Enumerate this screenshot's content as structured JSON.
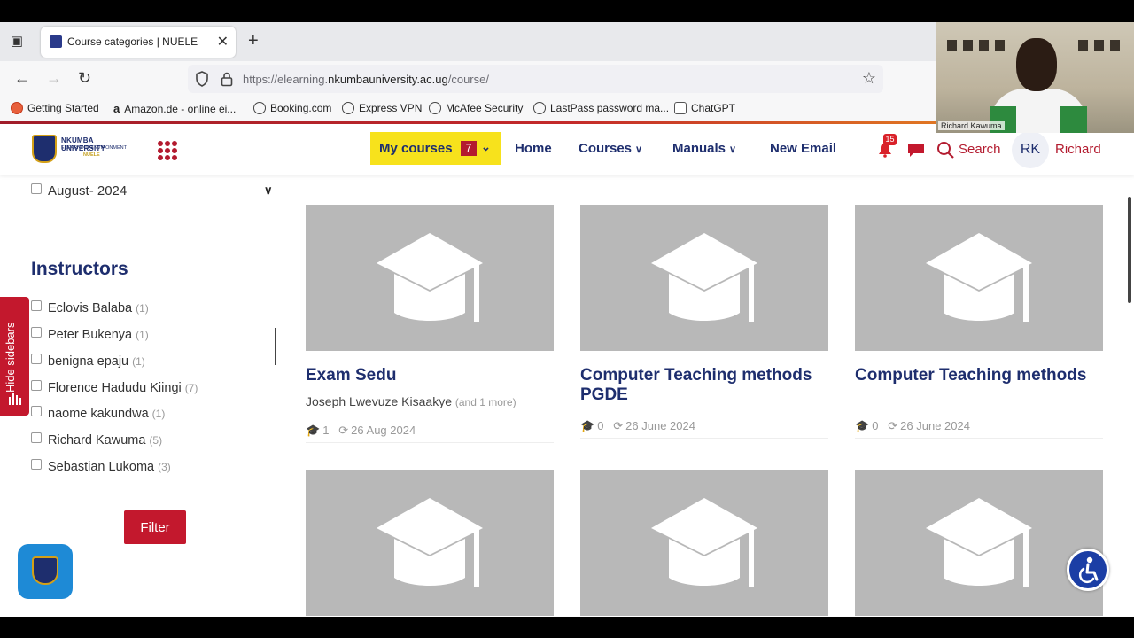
{
  "browser": {
    "tab_title": "Course categories | NUELE",
    "url_prefix": "https://elearning.",
    "url_domain": "nkumbauniversity.ac.ug",
    "url_path": "/course/",
    "bookmarks": [
      {
        "label": "Getting Started",
        "icon": "firefox-icon"
      },
      {
        "label": "Amazon.de - online ei...",
        "icon": "amazon-icon"
      },
      {
        "label": "Booking.com",
        "icon": "globe-icon"
      },
      {
        "label": "Express VPN",
        "icon": "globe-icon"
      },
      {
        "label": "McAfee Security",
        "icon": "globe-icon"
      },
      {
        "label": "LastPass password ma...",
        "icon": "globe-icon"
      },
      {
        "label": "ChatGPT",
        "icon": "chatgpt-icon"
      }
    ]
  },
  "header": {
    "logo_line1": "NKUMBA UNIVERSITY",
    "logo_line2": "ELEARNING ENVIRONMENT",
    "logo_line3": "NUELE",
    "my_courses_label": "My courses",
    "my_courses_count": "7",
    "menu": {
      "home": "Home",
      "courses": "Courses",
      "manuals": "Manuals",
      "new_email": "New Email"
    },
    "notifications_count": "15",
    "search_label": "Search",
    "avatar_initials": "RK",
    "user_name": "Richard"
  },
  "sidebar": {
    "date_filter": "August- 2024",
    "instructors_title": "Instructors",
    "instructors": [
      {
        "name": "Eclovis Balaba",
        "count": "(1)"
      },
      {
        "name": "Peter Bukenya",
        "count": "(1)"
      },
      {
        "name": "benigna epaju",
        "count": "(1)"
      },
      {
        "name": "Florence Hadudu Kiingi",
        "count": "(7)"
      },
      {
        "name": "naome kakundwa",
        "count": "(1)"
      },
      {
        "name": "Richard Kawuma",
        "count": "(5)"
      },
      {
        "name": "Sebastian Lukoma",
        "count": "(3)"
      }
    ],
    "filter_label": "Filter",
    "hide_sidebars_label": "Hide sidebars"
  },
  "courses": [
    {
      "title": "Exam Sedu",
      "author": "Joseph Lwevuze Kisaakye",
      "author_more": "(and 1 more)",
      "students": "1",
      "updated": "26 Aug 2024"
    },
    {
      "title": "Computer Teaching methods PGDE",
      "author": "",
      "author_more": "",
      "students": "0",
      "updated": "26 June 2024"
    },
    {
      "title": "Computer Teaching methods",
      "author": "",
      "author_more": "",
      "students": "0",
      "updated": "26 June 2024"
    }
  ],
  "webcam": {
    "participant_name": "Richard Kawuma"
  },
  "colors": {
    "brand_navy": "#1e2e6e",
    "brand_red": "#c3182d",
    "my_courses_yellow": "#f7e21c"
  }
}
